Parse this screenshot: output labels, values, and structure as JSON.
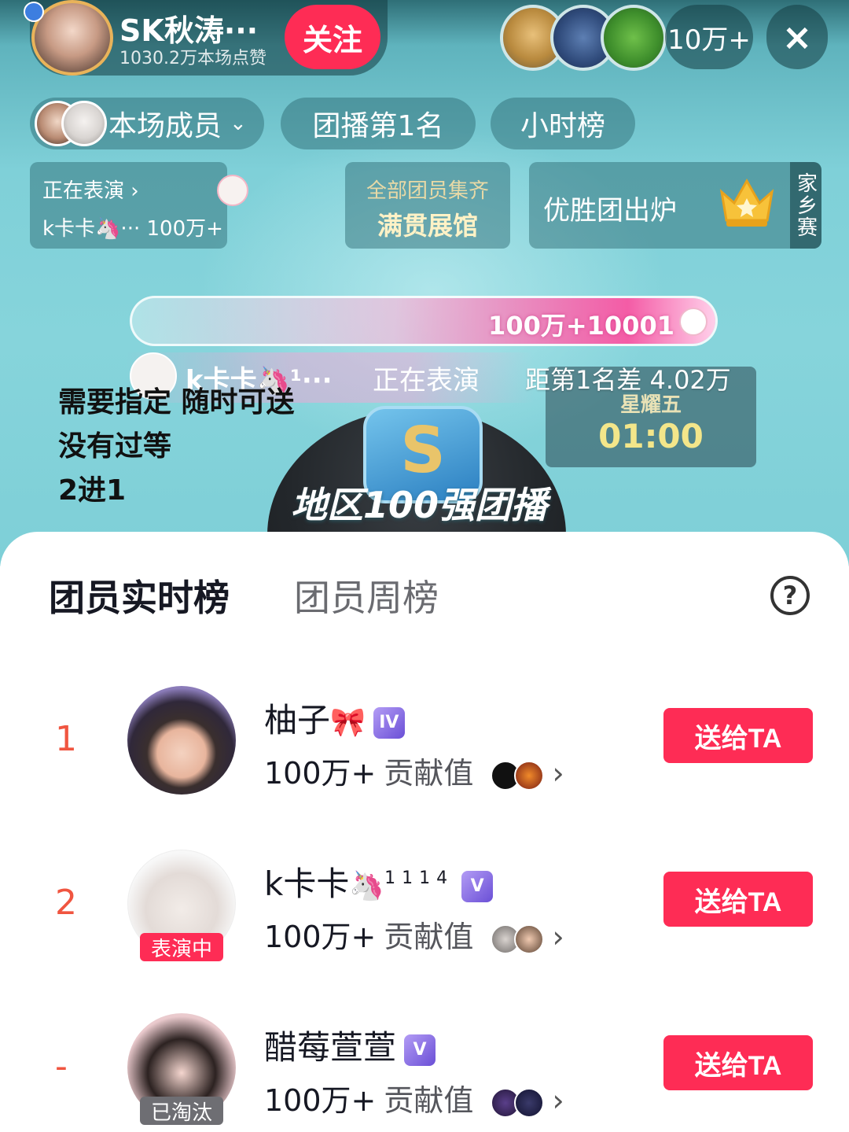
{
  "host": {
    "name": "SK秋涛···",
    "likes": "1030.2万本场点赞",
    "follow_label": "关注"
  },
  "viewers": {
    "count": "10万+",
    "close_icon": "×"
  },
  "tabs_top": {
    "members": "本场成员",
    "members_chevron": "⌄",
    "rank": "团播第1名",
    "hour": "小时榜"
  },
  "performing_card": {
    "title": "正在表演 ›",
    "name": "k卡卡🦄··· 100万+"
  },
  "hall_card": {
    "line1": "全部团员集齐",
    "line2": "满贯展馆"
  },
  "winner_card": {
    "title": "优胜团出炉",
    "tag": "家乡赛"
  },
  "progress": {
    "text": "100万+10001",
    "fill_fraction": 1.0
  },
  "strip": {
    "name": "k卡卡🦄¹···",
    "status": "正在表演",
    "gap": "距第1名差 4.02万"
  },
  "timer": {
    "day": "星耀五",
    "value": "01:00"
  },
  "rules_text": [
    "需要指定 随时可送",
    "没有过等",
    "2进1"
  ],
  "banner": {
    "text": "地区100强团播",
    "emblem_glyph": "S"
  },
  "sheet": {
    "tab_realtime": "团员实时榜",
    "tab_weekly": "团员周榜",
    "help_icon": "?",
    "rows": [
      {
        "rank": "1",
        "name": "柚子",
        "emoji": "🎀",
        "sup": "",
        "level": "IV",
        "tag": "",
        "contrib_value": "100万+",
        "contrib_label": "贡献值",
        "give_label": "送给TA"
      },
      {
        "rank": "2",
        "name": "k卡卡",
        "emoji": "🦄",
        "sup": "1114",
        "level": "V",
        "tag": "表演中",
        "contrib_value": "100万+",
        "contrib_label": "贡献值",
        "give_label": "送给TA"
      },
      {
        "rank": "-",
        "name": "醋莓萱萱",
        "emoji": "",
        "sup": "",
        "level": "V",
        "tag": "已淘汰",
        "contrib_value": "100万+",
        "contrib_label": "贡献值",
        "give_label": "送给TA"
      }
    ]
  },
  "colors": {
    "accent": "#fe2c55",
    "rank": "#f05540",
    "stage": "#7fd0d8"
  }
}
